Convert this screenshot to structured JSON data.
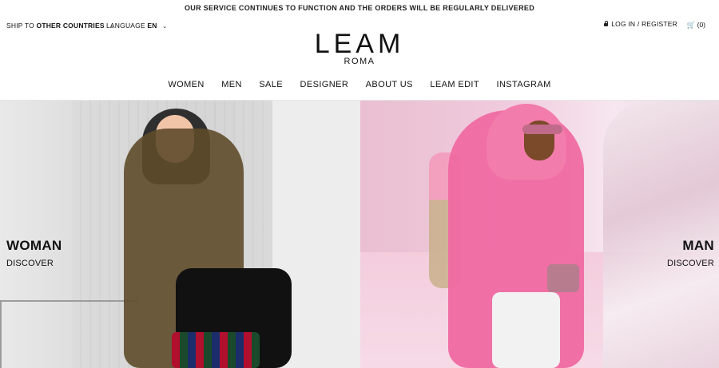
{
  "notice": "OUR SERVICE CONTINUES TO FUNCTION AND THE ORDERS WILL BE REGULARLY DELIVERED",
  "topbar": {
    "ship_prefix": "SHIP TO",
    "ship_value": "OTHER COUNTRIES",
    "language_prefix": "LANGUAGE",
    "language_value": "EN",
    "login": "LOG IN / REGISTER",
    "cart_count": "(0)"
  },
  "logo": {
    "main": "LEAM",
    "sub": "ROMA"
  },
  "nav": [
    "WOMEN",
    "MEN",
    "SALE",
    "DESIGNER",
    "ABOUT US",
    "LEAM EDIT",
    "INSTAGRAM"
  ],
  "hero": {
    "left": {
      "title": "WOMAN",
      "cta": "DISCOVER"
    },
    "right": {
      "title": "MAN",
      "cta": "DISCOVER"
    }
  },
  "colors": {
    "text": "#111111",
    "pink_accent": "#ef6aa2"
  },
  "icons": {
    "chevron": "chevron-down-icon",
    "lock": "lock-icon",
    "cart": "cart-icon"
  }
}
